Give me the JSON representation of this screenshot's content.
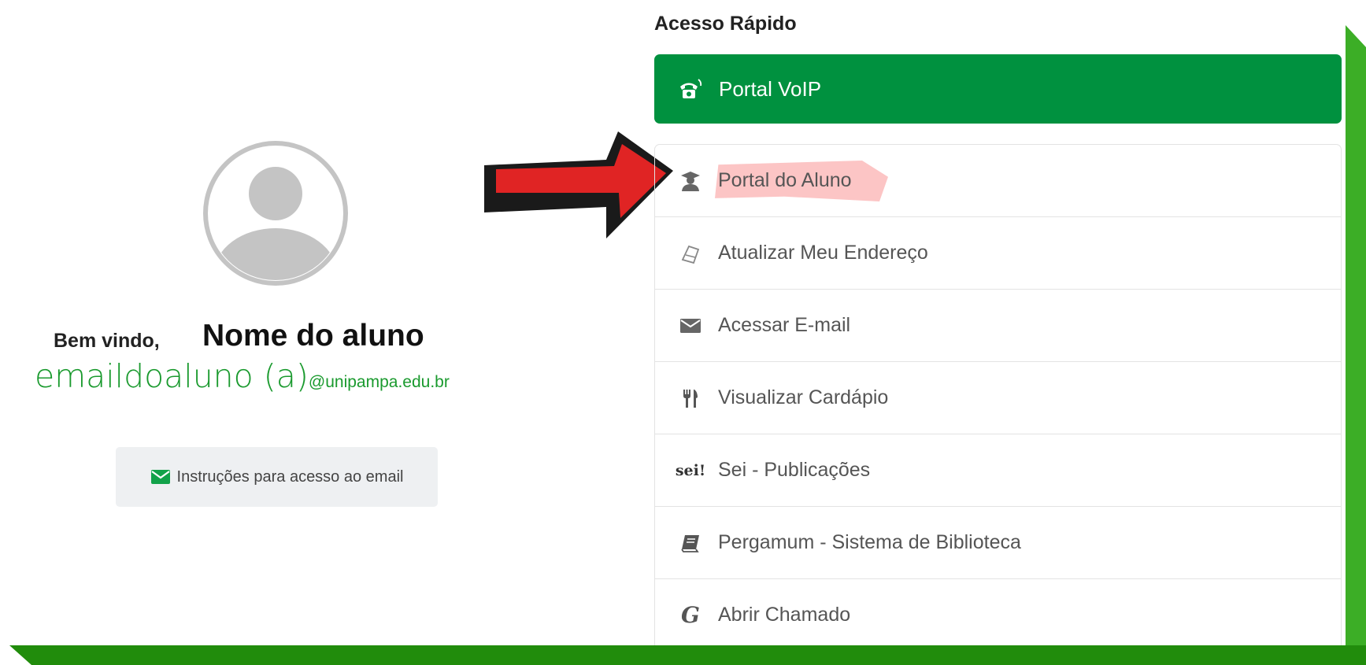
{
  "left_panel": {
    "welcome_label": "Bem vindo,",
    "student_name": "Nome do aluno",
    "email_user": "emaildoaluno (a)",
    "email_domain": "@unipampa.edu.br",
    "instructions_button": "Instruções para acesso ao email",
    "avatar_icon": "user-avatar-icon"
  },
  "right_panel": {
    "title": "Acesso Rápido",
    "voip": {
      "label": "Portal VoIP",
      "icon": "phone-icon"
    },
    "items": [
      {
        "label": "Portal do Aluno",
        "icon": "graduate-icon"
      },
      {
        "label": "Atualizar Meu Endereço",
        "icon": "map-icon"
      },
      {
        "label": "Acessar E-mail",
        "icon": "envelope-icon"
      },
      {
        "label": "Visualizar Cardápio",
        "icon": "cutlery-icon"
      },
      {
        "label": "Sei - Publicações",
        "icon": "sei-icon",
        "icon_text": "sei!"
      },
      {
        "label": "Pergamum - Sistema de Biblioteca",
        "icon": "book-icon"
      },
      {
        "label": "Abrir Chamado",
        "icon": "glpi-icon",
        "icon_text": "G"
      }
    ]
  },
  "colors": {
    "primary_green": "#00913f",
    "email_green": "#1a9a2e",
    "arrow_red": "#e02424",
    "frame_green": "#218c0c"
  }
}
